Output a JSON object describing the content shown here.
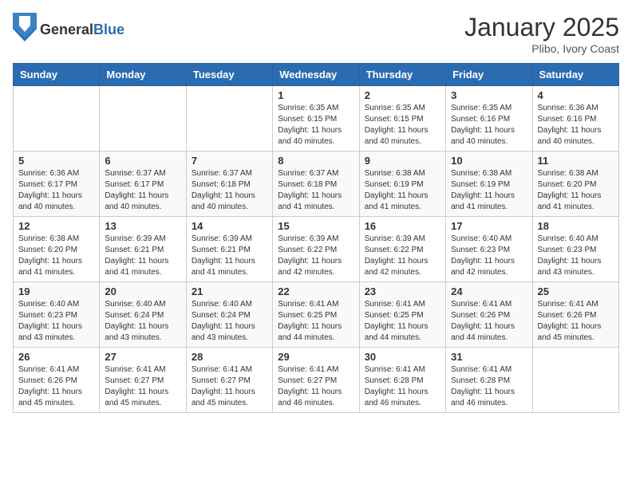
{
  "header": {
    "logo_general": "General",
    "logo_blue": "Blue",
    "month_title": "January 2025",
    "location": "Plibo, Ivory Coast"
  },
  "weekdays": [
    "Sunday",
    "Monday",
    "Tuesday",
    "Wednesday",
    "Thursday",
    "Friday",
    "Saturday"
  ],
  "weeks": [
    [
      {
        "day": "",
        "sunrise": "",
        "sunset": "",
        "daylight": ""
      },
      {
        "day": "",
        "sunrise": "",
        "sunset": "",
        "daylight": ""
      },
      {
        "day": "",
        "sunrise": "",
        "sunset": "",
        "daylight": ""
      },
      {
        "day": "1",
        "sunrise": "Sunrise: 6:35 AM",
        "sunset": "Sunset: 6:15 PM",
        "daylight": "Daylight: 11 hours and 40 minutes."
      },
      {
        "day": "2",
        "sunrise": "Sunrise: 6:35 AM",
        "sunset": "Sunset: 6:15 PM",
        "daylight": "Daylight: 11 hours and 40 minutes."
      },
      {
        "day": "3",
        "sunrise": "Sunrise: 6:35 AM",
        "sunset": "Sunset: 6:16 PM",
        "daylight": "Daylight: 11 hours and 40 minutes."
      },
      {
        "day": "4",
        "sunrise": "Sunrise: 6:36 AM",
        "sunset": "Sunset: 6:16 PM",
        "daylight": "Daylight: 11 hours and 40 minutes."
      }
    ],
    [
      {
        "day": "5",
        "sunrise": "Sunrise: 6:36 AM",
        "sunset": "Sunset: 6:17 PM",
        "daylight": "Daylight: 11 hours and 40 minutes."
      },
      {
        "day": "6",
        "sunrise": "Sunrise: 6:37 AM",
        "sunset": "Sunset: 6:17 PM",
        "daylight": "Daylight: 11 hours and 40 minutes."
      },
      {
        "day": "7",
        "sunrise": "Sunrise: 6:37 AM",
        "sunset": "Sunset: 6:18 PM",
        "daylight": "Daylight: 11 hours and 40 minutes."
      },
      {
        "day": "8",
        "sunrise": "Sunrise: 6:37 AM",
        "sunset": "Sunset: 6:18 PM",
        "daylight": "Daylight: 11 hours and 41 minutes."
      },
      {
        "day": "9",
        "sunrise": "Sunrise: 6:38 AM",
        "sunset": "Sunset: 6:19 PM",
        "daylight": "Daylight: 11 hours and 41 minutes."
      },
      {
        "day": "10",
        "sunrise": "Sunrise: 6:38 AM",
        "sunset": "Sunset: 6:19 PM",
        "daylight": "Daylight: 11 hours and 41 minutes."
      },
      {
        "day": "11",
        "sunrise": "Sunrise: 6:38 AM",
        "sunset": "Sunset: 6:20 PM",
        "daylight": "Daylight: 11 hours and 41 minutes."
      }
    ],
    [
      {
        "day": "12",
        "sunrise": "Sunrise: 6:38 AM",
        "sunset": "Sunset: 6:20 PM",
        "daylight": "Daylight: 11 hours and 41 minutes."
      },
      {
        "day": "13",
        "sunrise": "Sunrise: 6:39 AM",
        "sunset": "Sunset: 6:21 PM",
        "daylight": "Daylight: 11 hours and 41 minutes."
      },
      {
        "day": "14",
        "sunrise": "Sunrise: 6:39 AM",
        "sunset": "Sunset: 6:21 PM",
        "daylight": "Daylight: 11 hours and 41 minutes."
      },
      {
        "day": "15",
        "sunrise": "Sunrise: 6:39 AM",
        "sunset": "Sunset: 6:22 PM",
        "daylight": "Daylight: 11 hours and 42 minutes."
      },
      {
        "day": "16",
        "sunrise": "Sunrise: 6:39 AM",
        "sunset": "Sunset: 6:22 PM",
        "daylight": "Daylight: 11 hours and 42 minutes."
      },
      {
        "day": "17",
        "sunrise": "Sunrise: 6:40 AM",
        "sunset": "Sunset: 6:23 PM",
        "daylight": "Daylight: 11 hours and 42 minutes."
      },
      {
        "day": "18",
        "sunrise": "Sunrise: 6:40 AM",
        "sunset": "Sunset: 6:23 PM",
        "daylight": "Daylight: 11 hours and 43 minutes."
      }
    ],
    [
      {
        "day": "19",
        "sunrise": "Sunrise: 6:40 AM",
        "sunset": "Sunset: 6:23 PM",
        "daylight": "Daylight: 11 hours and 43 minutes."
      },
      {
        "day": "20",
        "sunrise": "Sunrise: 6:40 AM",
        "sunset": "Sunset: 6:24 PM",
        "daylight": "Daylight: 11 hours and 43 minutes."
      },
      {
        "day": "21",
        "sunrise": "Sunrise: 6:40 AM",
        "sunset": "Sunset: 6:24 PM",
        "daylight": "Daylight: 11 hours and 43 minutes."
      },
      {
        "day": "22",
        "sunrise": "Sunrise: 6:41 AM",
        "sunset": "Sunset: 6:25 PM",
        "daylight": "Daylight: 11 hours and 44 minutes."
      },
      {
        "day": "23",
        "sunrise": "Sunrise: 6:41 AM",
        "sunset": "Sunset: 6:25 PM",
        "daylight": "Daylight: 11 hours and 44 minutes."
      },
      {
        "day": "24",
        "sunrise": "Sunrise: 6:41 AM",
        "sunset": "Sunset: 6:26 PM",
        "daylight": "Daylight: 11 hours and 44 minutes."
      },
      {
        "day": "25",
        "sunrise": "Sunrise: 6:41 AM",
        "sunset": "Sunset: 6:26 PM",
        "daylight": "Daylight: 11 hours and 45 minutes."
      }
    ],
    [
      {
        "day": "26",
        "sunrise": "Sunrise: 6:41 AM",
        "sunset": "Sunset: 6:26 PM",
        "daylight": "Daylight: 11 hours and 45 minutes."
      },
      {
        "day": "27",
        "sunrise": "Sunrise: 6:41 AM",
        "sunset": "Sunset: 6:27 PM",
        "daylight": "Daylight: 11 hours and 45 minutes."
      },
      {
        "day": "28",
        "sunrise": "Sunrise: 6:41 AM",
        "sunset": "Sunset: 6:27 PM",
        "daylight": "Daylight: 11 hours and 45 minutes."
      },
      {
        "day": "29",
        "sunrise": "Sunrise: 6:41 AM",
        "sunset": "Sunset: 6:27 PM",
        "daylight": "Daylight: 11 hours and 46 minutes."
      },
      {
        "day": "30",
        "sunrise": "Sunrise: 6:41 AM",
        "sunset": "Sunset: 6:28 PM",
        "daylight": "Daylight: 11 hours and 46 minutes."
      },
      {
        "day": "31",
        "sunrise": "Sunrise: 6:41 AM",
        "sunset": "Sunset: 6:28 PM",
        "daylight": "Daylight: 11 hours and 46 minutes."
      },
      {
        "day": "",
        "sunrise": "",
        "sunset": "",
        "daylight": ""
      }
    ]
  ]
}
